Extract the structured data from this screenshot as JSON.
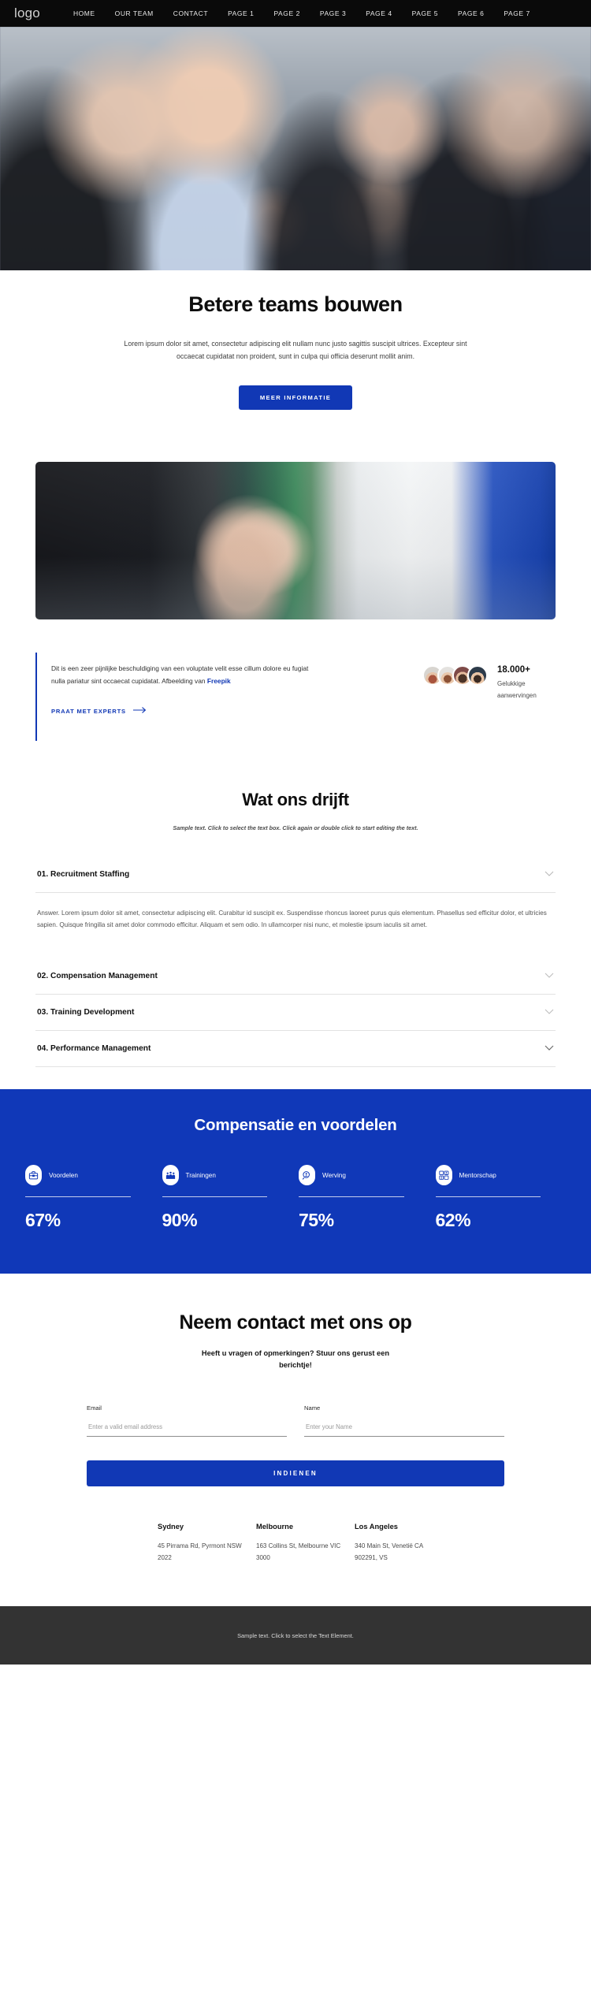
{
  "header": {
    "logo": "logo",
    "nav": [
      {
        "label": "HOME"
      },
      {
        "label": "OUR TEAM"
      },
      {
        "label": "CONTACT"
      },
      {
        "label": "PAGE 1"
      },
      {
        "label": "PAGE 2"
      },
      {
        "label": "PAGE 3"
      },
      {
        "label": "PAGE 4"
      },
      {
        "label": "PAGE 5"
      },
      {
        "label": "PAGE 6"
      },
      {
        "label": "PAGE 7"
      }
    ]
  },
  "hero": {
    "title": "Betere teams bouwen",
    "subtitle": "Lorem ipsum dolor sit amet, consectetur adipiscing elit nullam nunc justo sagittis suscipit ultrices. Excepteur sint occaecat cupidatat non proident, sunt in culpa qui officia deserunt mollit anim.",
    "cta_label": "MEER INFORMATIE"
  },
  "quote": {
    "text_before": "Dit is een zeer pijnlijke beschuldiging van een voluptate velit esse cillum dolore eu fugiat nulla pariatur sint occaecat cupidatat. Afbeelding van ",
    "link_label": "Freepik",
    "cta_label": "PRAAT MET EXPERTS",
    "arrow_icon": "arrow-right-icon",
    "stat_number": "18.000+",
    "stat_label": "Gelukkige aanwervingen",
    "avatars": [
      "avatar-1",
      "avatar-2",
      "avatar-3",
      "avatar-4"
    ]
  },
  "accordion": {
    "title": "Wat ons drijft",
    "subtitle": "Sample text. Click to select the text box. Click again or double click to start editing the text.",
    "items": [
      {
        "title": "01. Recruitment Staffing",
        "expanded": true,
        "body": "Answer. Lorem ipsum dolor sit amet, consectetur adipiscing elit. Curabitur id suscipit ex. Suspendisse rhoncus laoreet purus quis elementum. Phasellus sed efficitur dolor, et ultricies sapien. Quisque fringilla sit amet dolor commodo efficitur. Aliquam et sem odio. In ullamcorper nisi nunc, et molestie ipsum iaculis sit amet."
      },
      {
        "title": "02. Compensation Management",
        "expanded": false,
        "body": ""
      },
      {
        "title": "03. Training Development",
        "expanded": false,
        "body": ""
      },
      {
        "title": "04. Performance Management",
        "expanded": false,
        "body": ""
      }
    ]
  },
  "benefits": {
    "title": "Compensatie en voordelen",
    "accent_color": "#1038b8",
    "items": [
      {
        "label": "Voordelen",
        "value": "67%",
        "icon": "briefcase-icon"
      },
      {
        "label": "Trainingen",
        "value": "90%",
        "icon": "people-group-icon"
      },
      {
        "label": "Werving",
        "value": "75%",
        "icon": "magnifier-person-icon"
      },
      {
        "label": "Mentorschap",
        "value": "62%",
        "icon": "id-cards-icon"
      }
    ]
  },
  "contact": {
    "title": "Neem contact met ons op",
    "subtitle": "Heeft u vragen of opmerkingen? Stuur ons gerust een berichtje!",
    "email_label": "Email",
    "email_placeholder": "Enter a valid email address",
    "email_value": "",
    "name_label": "Name",
    "name_placeholder": "Enter your Name",
    "name_value": "",
    "submit_label": "INDIENEN",
    "offices": [
      {
        "city": "Sydney",
        "address": "45 Pirrama Rd, Pyrmont NSW 2022"
      },
      {
        "city": "Melbourne",
        "address": "163 Collins St, Melbourne VIC 3000"
      },
      {
        "city": "Los Angeles",
        "address": "340 Main St, Venetië CA 902291, VS"
      }
    ]
  },
  "footer": {
    "text": "Sample text. Click to select the Text Element."
  }
}
